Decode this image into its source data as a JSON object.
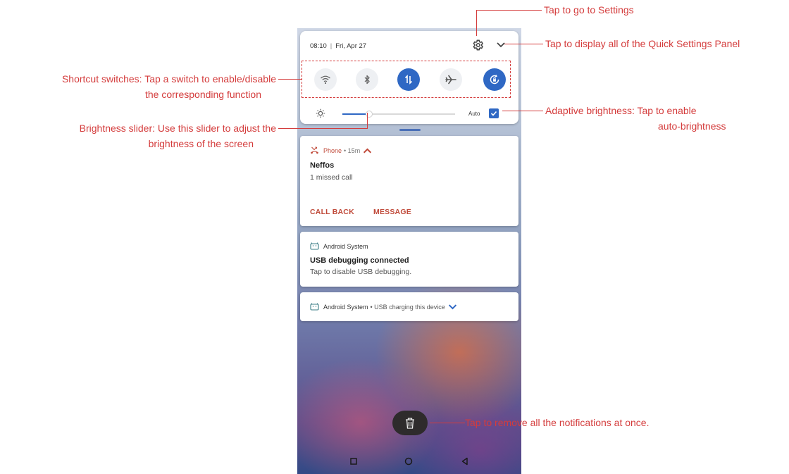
{
  "status": {
    "time": "08:10",
    "date": "Fri, Apr 27"
  },
  "toggles": [
    {
      "icon": "wifi-icon",
      "on": false
    },
    {
      "icon": "bluetooth-icon",
      "on": false
    },
    {
      "icon": "mobile-data-icon",
      "on": true
    },
    {
      "icon": "airplane-mode-icon",
      "on": false
    },
    {
      "icon": "auto-rotate-icon",
      "on": true
    }
  ],
  "brightness": {
    "level": 0.24,
    "auto_label": "Auto",
    "auto_enabled": true
  },
  "notifications": {
    "phone": {
      "app": "Phone",
      "meta": "• 15m",
      "title": "Neffos",
      "text": "1 missed call",
      "action_callback": "CALL BACK",
      "action_message": "MESSAGE"
    },
    "usb_debug": {
      "app": "Android System",
      "title": "USB debugging connected",
      "text": "Tap to disable USB debugging."
    },
    "usb_charging": {
      "app": "Android System",
      "meta": "• USB charging this device"
    }
  },
  "annotations": {
    "settings": "Tap to go to Settings",
    "expand": "Tap to display all of the Quick Settings Panel",
    "shortcut_1": "Shortcut switches: Tap a switch to enable/disable",
    "shortcut_2": "the corresponding function",
    "brightness_1": "Brightness slider: Use this slider to adjust the",
    "brightness_2": "brightness of the screen",
    "adaptive_1": "Adaptive brightness: Tap to enable",
    "adaptive_2": "auto-brightness",
    "clear_all": "Tap to remove all the notifications at once."
  },
  "colors": {
    "accent": "#2f68c4",
    "annotation": "#d43c3c",
    "action": "#c04a3a"
  }
}
